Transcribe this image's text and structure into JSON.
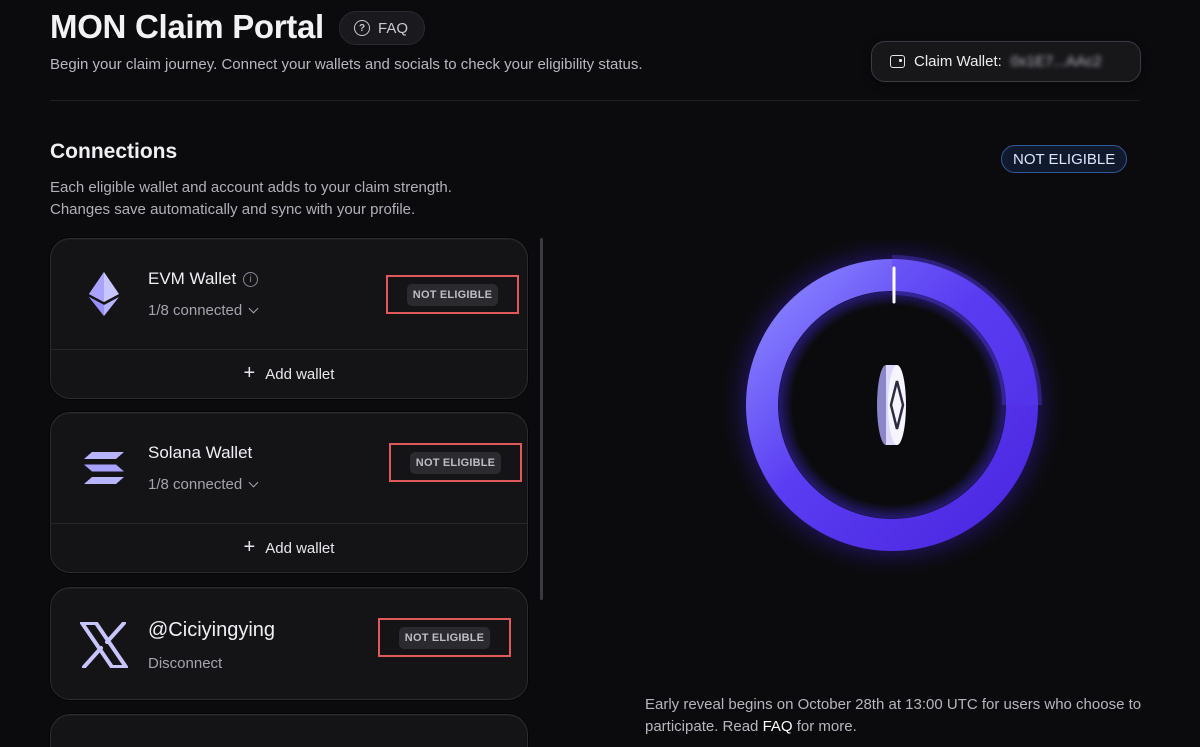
{
  "header": {
    "title": "MON Claim Portal",
    "faq_label": "FAQ",
    "subtitle": "Begin your claim journey. Connect your wallets and socials to check your eligibility status.",
    "claim_wallet_label": "Claim Wallet:",
    "claim_wallet_address": "0x1E7...AAc2"
  },
  "connections": {
    "title": "Connections",
    "description_line1": "Each eligible wallet and account adds to your claim strength.",
    "description_line2": "Changes save automatically and sync with your profile.",
    "cards": [
      {
        "name": "EVM Wallet",
        "icon": "ethereum-icon",
        "status": "1/8 connected",
        "badge": "NOT ELIGIBLE",
        "action": "Add wallet"
      },
      {
        "name": "Solana Wallet",
        "icon": "solana-icon",
        "status": "1/8 connected",
        "badge": "NOT ELIGIBLE",
        "action": "Add wallet"
      },
      {
        "name": "@Ciciyingying",
        "icon": "x-logo-icon",
        "status": "Disconnect",
        "badge": "NOT ELIGIBLE"
      }
    ]
  },
  "eligibility": {
    "status": "NOT ELIGIBLE",
    "note_part1": "Early reveal begins on October 28th at 13:00 UTC for users who choose to participate. Read ",
    "note_link": "FAQ",
    "note_part2": " for more."
  },
  "colors": {
    "background": "#0b0b0d",
    "ring_accent": "#5b3cff",
    "highlight_box": "#e05a5a",
    "status_pill_border": "#2f5a9a"
  }
}
